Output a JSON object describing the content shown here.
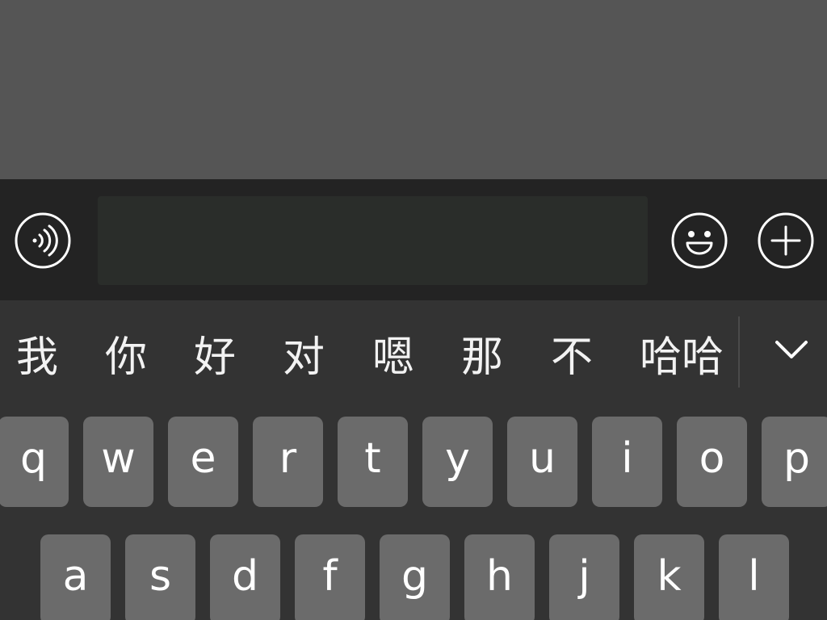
{
  "input_bar": {
    "voice_button": {
      "icon": "voice-input-icon"
    },
    "message_input": {
      "value": "",
      "placeholder": ""
    },
    "emoji_button": {
      "icon": "smiley-face-icon"
    },
    "plus_button": {
      "icon": "plus-circle-icon"
    }
  },
  "keyboard": {
    "candidates": [
      "我",
      "你",
      "好",
      "对",
      "嗯",
      "那",
      "不",
      "哈哈"
    ],
    "collapse_icon": "chevron-down-icon",
    "rows": [
      [
        "q",
        "w",
        "e",
        "r",
        "t",
        "y",
        "u",
        "i",
        "o",
        "p"
      ],
      [
        "a",
        "s",
        "d",
        "f",
        "g",
        "h",
        "j",
        "k",
        "l"
      ]
    ]
  },
  "colors": {
    "chat_background": "#555555",
    "input_bar_background": "#232323",
    "text_field_background": "#2a2d2a",
    "keyboard_background": "#333333",
    "key_background": "#6b6b6b",
    "key_text": "#ffffff"
  }
}
